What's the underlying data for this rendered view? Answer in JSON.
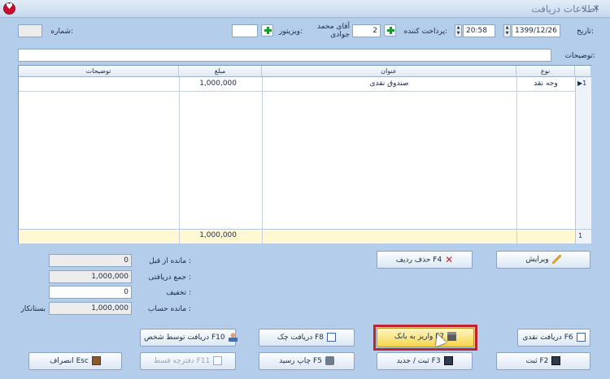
{
  "window": {
    "title": "اطلاعات دریافت",
    "minimize": "–",
    "close": "×"
  },
  "header": {
    "number_label": "شماره:",
    "visitor_label": "ویزیتور:",
    "payer_label": "پرداخت کننده:",
    "payer_code": "2",
    "payer_name": "آقای محمد جوادی",
    "date_label": "تاریخ:",
    "time": "20:58",
    "date": "1399/12/26",
    "notes_label": "توضیحات:"
  },
  "grid": {
    "columns": {
      "type": "نوع",
      "title": "عنوان",
      "amount": "مبلغ",
      "notes": "توضیحات"
    },
    "rows": [
      {
        "type": "وجه نقد",
        "title": "صندوق نقدی",
        "amount": "1,000,000",
        "notes": ""
      }
    ],
    "row_indicator": "▶1",
    "footer_index": "1",
    "footer_total": "1,000,000"
  },
  "buttons": {
    "edit": "ویرایش",
    "delete_row": "حذف ردیف F4",
    "cash": "دریافت نقدی F6",
    "bank": "واریز به بانک F7",
    "check": "دریافت چک F8",
    "by_person": "دریافت توسط شخص F10",
    "save": "ثبت F2",
    "save_new": "ثبت / جدید F3",
    "print": "چاپ رسید F5",
    "installment": "دفترچه قسط F11",
    "cancel": "انصراف Esc"
  },
  "summary": {
    "prev_balance_label": "مانده از قبل :",
    "prev_balance": "0",
    "total_label": "جمع دریافتی :",
    "total": "1,000,000",
    "discount_label": "تخفیف :",
    "discount": "0",
    "balance_label": "مانده حساب :",
    "balance": "1,000,000",
    "balance_status": "بستانکار"
  },
  "colors": {
    "background": "#b4cdea",
    "highlight_button": "#f5d44a",
    "red_frame": "#c0242a"
  },
  "icons": [
    "app-logo",
    "plus-icon",
    "pencil-icon",
    "x-icon",
    "document-icon",
    "bank-icon",
    "person-icon",
    "floppy-icon",
    "printer-icon",
    "door-icon",
    "mouse-cursor"
  ]
}
